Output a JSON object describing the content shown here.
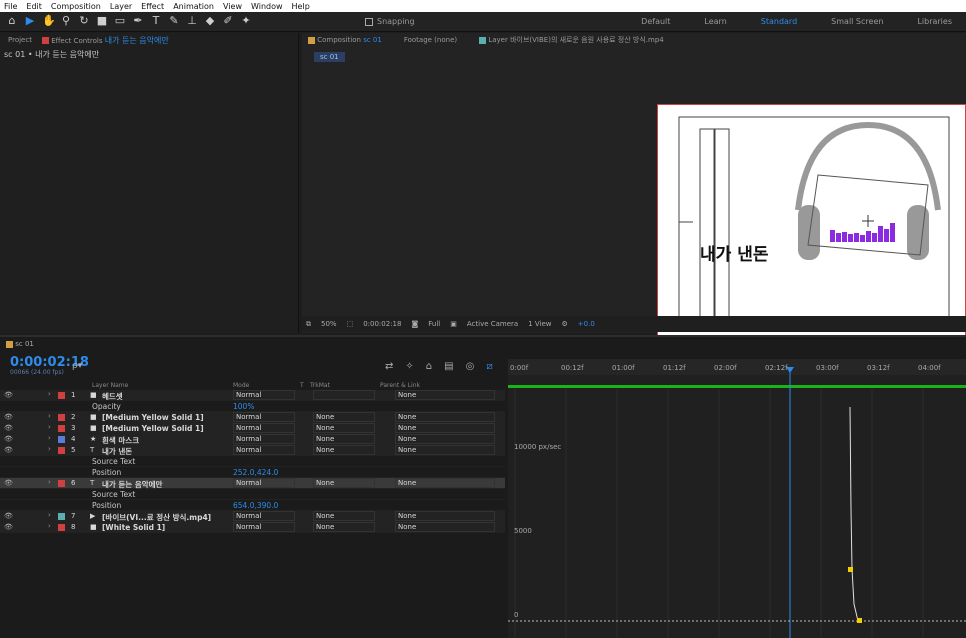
{
  "menu": [
    "File",
    "Edit",
    "Composition",
    "Layer",
    "Effect",
    "Animation",
    "View",
    "Window",
    "Help"
  ],
  "toolbar": {
    "snapping_label": "Snapping",
    "workspaces": [
      "Default",
      "Learn",
      "Standard",
      "Small Screen",
      "Libraries"
    ],
    "active_workspace": "Standard"
  },
  "left_panel": {
    "tab_project": "Project",
    "tab_effects_prefix": "Effect Controls",
    "tab_effects_layer": "내가 듣는 음악에만",
    "sub": "sc 01 • 내가 듣는 음악에만"
  },
  "comp_panel": {
    "tab_comp_prefix": "Composition",
    "tab_comp_name": "sc 01",
    "tab_footage": "Footage (none)",
    "tab_layer": "Layer 바이브(VIBE)의 새로운 음원 사용료 정산 방식.mp4",
    "chip": "sc 01",
    "canvas_text": "내가 낸돈",
    "viewer": {
      "zoom": "50%",
      "timecode": "0:00:02:18",
      "resolution": "Full",
      "camera": "Active Camera",
      "views": "1 View",
      "exposure": "+0.0"
    }
  },
  "timeline": {
    "tab": "sc 01",
    "timecode": "0:00:02:18",
    "fps": "00066 (24.00 fps)",
    "search_placeholder": "ρ▾",
    "columns": {
      "layer_name": "Layer Name",
      "mode": "Mode",
      "t": "T",
      "trkmat": "TrkMat",
      "parent": "Parent & Link"
    },
    "rows": [
      {
        "type": "layer",
        "num": "1",
        "name": "헤드셋",
        "color": "#d04040",
        "icon": "■",
        "mode": "Normal",
        "trkmat": "",
        "parent": "None"
      },
      {
        "type": "prop",
        "name": "Opacity",
        "value": "100%"
      },
      {
        "type": "layer",
        "num": "2",
        "name": "[Medium Yellow Solid 1]",
        "color": "#d04040",
        "icon": "■",
        "mode": "Normal",
        "trkmat": "None",
        "parent": "None"
      },
      {
        "type": "layer",
        "num": "3",
        "name": "[Medium Yellow Solid 1]",
        "color": "#d04040",
        "icon": "■",
        "mode": "Normal",
        "trkmat": "None",
        "parent": "None"
      },
      {
        "type": "layer",
        "num": "4",
        "name": "흰색 마스크",
        "color": "#5a7bd8",
        "icon": "★",
        "mode": "Normal",
        "trkmat": "None",
        "parent": "None"
      },
      {
        "type": "layer",
        "num": "5",
        "name": "내가 낸돈",
        "color": "#d04040",
        "icon": "T",
        "mode": "Normal",
        "trkmat": "None",
        "parent": "None"
      },
      {
        "type": "prop",
        "name": "Source Text",
        "value": ""
      },
      {
        "type": "prop",
        "name": "Position",
        "value": "252.0,424.0"
      },
      {
        "type": "layer",
        "num": "6",
        "name": "내가 듣는 음악에만",
        "color": "#d04040",
        "icon": "T",
        "mode": "Normal",
        "trkmat": "None",
        "parent": "None",
        "selected": true
      },
      {
        "type": "prop",
        "name": "Source Text",
        "value": ""
      },
      {
        "type": "prop",
        "name": "Position",
        "value": "654.0,390.0"
      },
      {
        "type": "layer",
        "num": "7",
        "name": "[바이브(VI...료 정산 방식.mp4]",
        "color": "#5ab0b0",
        "icon": "▶",
        "mode": "Normal",
        "trkmat": "None",
        "parent": "None"
      },
      {
        "type": "layer",
        "num": "8",
        "name": "[White Solid 1]",
        "color": "#d04040",
        "icon": "■",
        "mode": "Normal",
        "trkmat": "None",
        "parent": "None"
      }
    ],
    "ruler": [
      "0:00f",
      "00:12f",
      "01:00f",
      "01:12f",
      "02:00f",
      "02:12f",
      "03:00f",
      "03:12f",
      "04:00f",
      "04"
    ],
    "graph_labels": [
      "10000 px/sec",
      "5000",
      "0"
    ],
    "colors": {
      "accent": "#2d8ceb",
      "green": "#1ab31a",
      "keyframe": "#f0d000"
    }
  }
}
